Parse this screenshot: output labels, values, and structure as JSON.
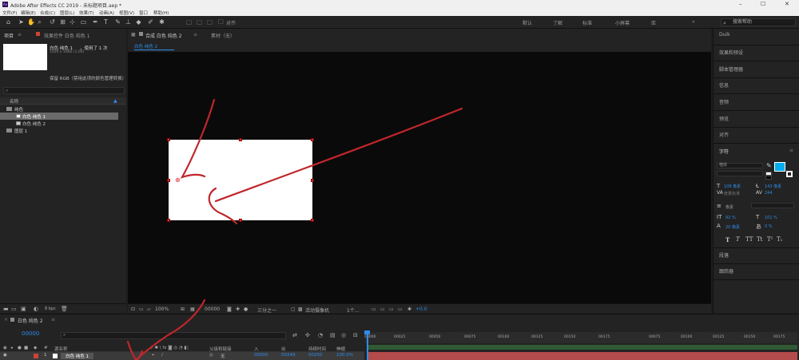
{
  "app": {
    "title": "Adobe After Effects CC 2019 - 未标题项目.aep *",
    "logo_text": "Ae"
  },
  "menu": [
    "文件(F)",
    "编辑(E)",
    "合成(C)",
    "图层(L)",
    "效果(T)",
    "动画(A)",
    "视图(V)",
    "窗口",
    "帮助(H)"
  ],
  "toolbar": {
    "align_label": "对齐",
    "workspaces": [
      "默认",
      "了解",
      "标准",
      "小屏幕",
      "库",
      "»"
    ],
    "search_help": "搜索帮助"
  },
  "project_panel": {
    "tab_project": "项目",
    "tab_effects": "效果控件 白色 纯色 1",
    "selected_name": "白色 纯色 1",
    "used_count": "，使用了 1 次",
    "dimensions": "1920 x 1080 (1.00)",
    "note": "保留 RGB（禁用此项的颜色管理转换）",
    "col_name": "名称",
    "items": [
      {
        "name": "纯色",
        "type": "folder"
      },
      {
        "name": "白色 纯色 1",
        "type": "solid",
        "selected": true
      },
      {
        "name": "白色 纯色 2",
        "type": "solid"
      },
      {
        "name": "图层 1",
        "type": "folder"
      }
    ],
    "bpc": "8 bpc"
  },
  "comp_panel": {
    "tab_comp": "合成 白色 纯色 2",
    "tab_footage": "素材（无）",
    "subtab": "白色 纯色 2",
    "zoom": "100%",
    "timecode": "00000",
    "resolution": "三分之一",
    "camera": "活动摄像机",
    "views": "1个...",
    "exposure": "+0.0"
  },
  "right_panel": {
    "sections": [
      "Duik",
      "效果和预设",
      "脚本管理器",
      "信息",
      "音频",
      "预览",
      "对齐"
    ],
    "char_title": "字符",
    "font": "楷体",
    "font_size": "108 像素",
    "leading": "143 像素",
    "tracking_label": "度量标准",
    "tracking": "244",
    "stroke_unit": "像素",
    "vscale": "92 %",
    "hscale": "101 %",
    "baseline": "20 像素",
    "tsume": "0 %",
    "text_styles": [
      "T",
      "T",
      "TT",
      "Tt",
      "T¹",
      "T₁"
    ],
    "bottom_sections": [
      "段落",
      "跟踪器"
    ],
    "fill_color": "#00aeef"
  },
  "timeline": {
    "tab": "白色 纯色 2",
    "timecode": "00000",
    "ruler_ticks": [
      "00000",
      "00025",
      "00050",
      "00075",
      "00100",
      "00125",
      "00150",
      "00175",
      "00075",
      "00100",
      "00125",
      "00150",
      "00175"
    ],
    "headers": [
      "源名称",
      "父级和链接",
      "入",
      "出",
      "持续时间",
      "伸缩"
    ],
    "layer": {
      "index": "1",
      "name": "白色 纯色 1",
      "parent": "无",
      "in": "00000",
      "out": "00249",
      "duration": "00250",
      "stretch": "100.0%"
    }
  }
}
